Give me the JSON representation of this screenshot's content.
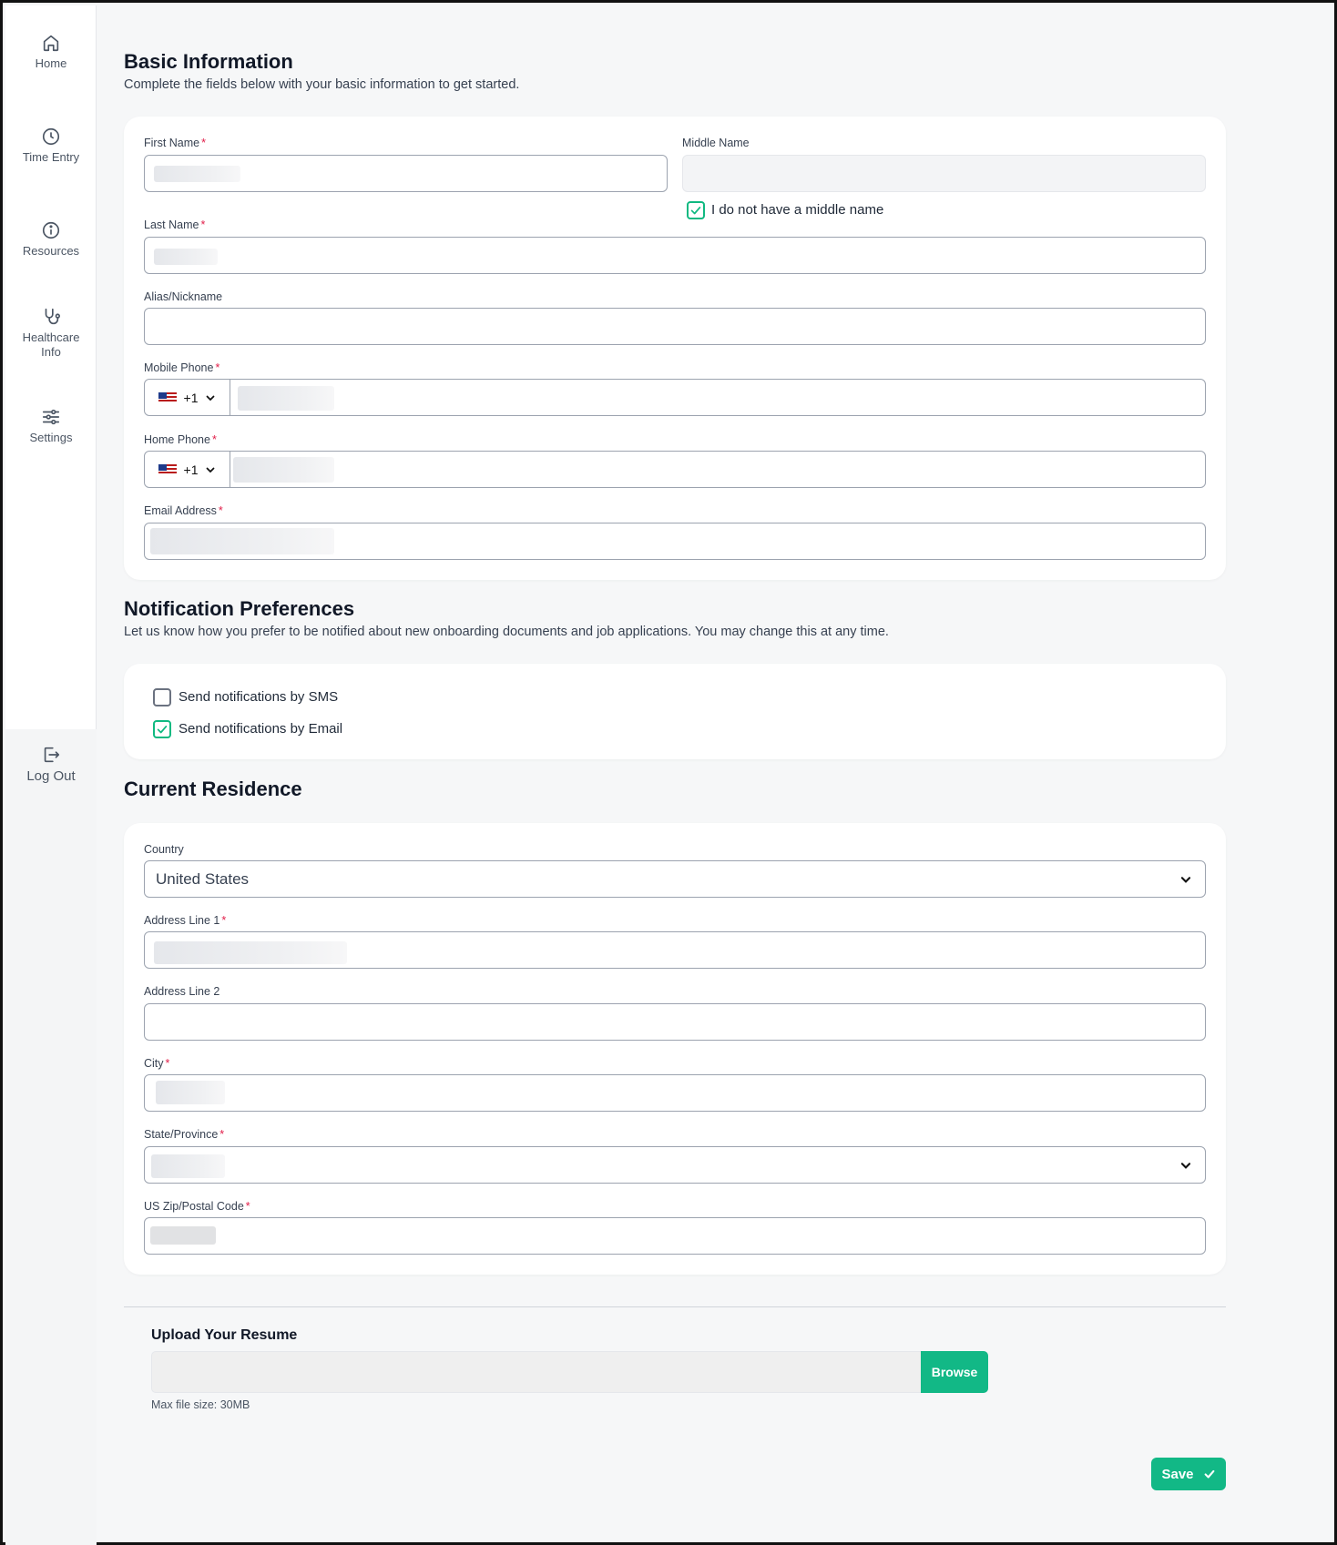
{
  "sidebar": {
    "items": [
      {
        "label": "Home",
        "icon": "home-icon"
      },
      {
        "label": "Time Entry",
        "icon": "clock-icon"
      },
      {
        "label": "Resources",
        "icon": "info-icon"
      },
      {
        "label": "Healthcare",
        "label2": "Info",
        "icon": "stethoscope-icon"
      },
      {
        "label": "Settings",
        "icon": "sliders-icon"
      }
    ],
    "logout": {
      "label": "Log Out",
      "icon": "logout-icon"
    }
  },
  "basic": {
    "title": "Basic Information",
    "subtitle": "Complete the fields below with your basic information to get started.",
    "first_name_label": "First Name",
    "middle_name_label": "Middle Name",
    "no_middle_label": "I do not have a middle name",
    "no_middle_checked": true,
    "last_name_label": "Last Name",
    "alias_label": "Alias/Nickname",
    "mobile_label": "Mobile Phone",
    "mobile_code": "+1",
    "home_label": "Home Phone",
    "home_code": "+1",
    "email_label": "Email Address",
    "required_mark": "*"
  },
  "notifications": {
    "title": "Notification Preferences",
    "subtitle": "Let us know how you prefer to be notified about new onboarding documents and job applications. You may change this at any time.",
    "sms_label": "Send notifications by SMS",
    "sms_checked": false,
    "email_label": "Send notifications by Email",
    "email_checked": true
  },
  "residence": {
    "title": "Current Residence",
    "country_label": "Country",
    "country_value": "United States",
    "address1_label": "Address Line 1",
    "address2_label": "Address Line 2",
    "city_label": "City",
    "state_label": "State/Province",
    "zip_label": "US Zip/Postal Code"
  },
  "upload": {
    "title": "Upload Your Resume",
    "browse_label": "Browse",
    "hint": "Max file size: 30MB"
  },
  "save_label": "Save",
  "colors": {
    "accent": "#12b886",
    "required": "#e11d48",
    "check": "#10b981"
  }
}
